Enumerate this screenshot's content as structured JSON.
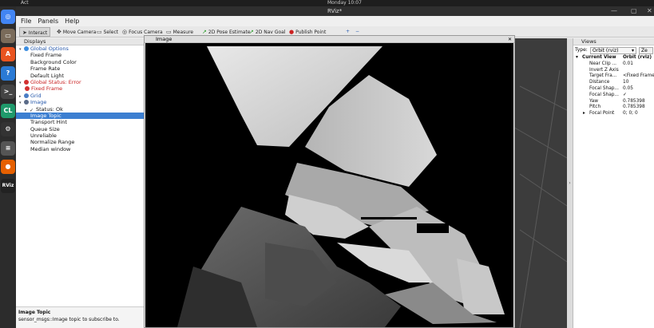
{
  "topbar": {
    "activities": "Act",
    "clock": "Monday 10:07"
  },
  "window": {
    "title": "RViz*"
  },
  "menu": [
    "File",
    "Panels",
    "Help"
  ],
  "toolbar": [
    {
      "label": "Interact",
      "icon": "cursor-icon",
      "active": true
    },
    {
      "label": "Move Camera",
      "icon": "move-camera-icon",
      "active": false
    },
    {
      "label": "Select",
      "icon": "select-icon",
      "active": false
    },
    {
      "label": "Focus Camera",
      "icon": "focus-camera-icon",
      "active": false
    },
    {
      "label": "Measure",
      "icon": "measure-icon",
      "active": false
    },
    {
      "label": "2D Pose Estimate",
      "icon": "pose-estimate-icon",
      "active": false
    },
    {
      "label": "2D Nav Goal",
      "icon": "nav-goal-icon",
      "active": false
    },
    {
      "label": "Publish Point",
      "icon": "publish-point-icon",
      "active": false
    }
  ],
  "displays": {
    "header": "Displays",
    "items": [
      {
        "text": "Global Options",
        "indent": 0,
        "twisty": "▾",
        "kind": "gear",
        "style": "blue"
      },
      {
        "text": "Fixed Frame",
        "indent": 2,
        "style": ""
      },
      {
        "text": "Background Color",
        "indent": 2,
        "style": ""
      },
      {
        "text": "Frame Rate",
        "indent": 2,
        "style": ""
      },
      {
        "text": "Default Light",
        "indent": 2,
        "style": ""
      },
      {
        "text": "Global Status: Error",
        "indent": 0,
        "twisty": "▾",
        "kind": "error",
        "style": "err"
      },
      {
        "text": "Fixed Frame",
        "indent": 1,
        "kind": "error",
        "style": "err"
      },
      {
        "text": "Grid",
        "indent": 0,
        "twisty": "▸",
        "kind": "grid",
        "style": "blue"
      },
      {
        "text": "Image",
        "indent": 0,
        "twisty": "▾",
        "kind": "image",
        "style": "blue"
      },
      {
        "text": "Status: Ok",
        "indent": 1,
        "twisty": "▸",
        "kind": "ok",
        "style": ""
      },
      {
        "text": "Image Topic",
        "indent": 2,
        "style": "",
        "selected": true
      },
      {
        "text": "Transport Hint",
        "indent": 2,
        "style": ""
      },
      {
        "text": "Queue Size",
        "indent": 2,
        "style": ""
      },
      {
        "text": "Unreliable",
        "indent": 2,
        "style": ""
      },
      {
        "text": "Normalize Range",
        "indent": 2,
        "style": ""
      },
      {
        "text": "Median window",
        "indent": 2,
        "style": ""
      }
    ],
    "description_title": "Image Topic",
    "description_text": "sensor_msgs::Image topic to subscribe to."
  },
  "image_panel": {
    "title": "Image"
  },
  "views": {
    "header": "Views",
    "type_label": "Type:",
    "type_value": "Orbit (rviz)",
    "zero_button": "Ze",
    "rows": [
      {
        "key": "Current View",
        "value": "Orbit (rviz)",
        "head": true
      },
      {
        "key": "Near Clip ...",
        "value": "0.01"
      },
      {
        "key": "Invert Z Axis",
        "value": ""
      },
      {
        "key": "Target Fra...",
        "value": "<Fixed Frame"
      },
      {
        "key": "Distance",
        "value": "10"
      },
      {
        "key": "Focal Shap...",
        "value": "0.05"
      },
      {
        "key": "Focal Shap...",
        "value": "✓"
      },
      {
        "key": "Yaw",
        "value": "0.785398"
      },
      {
        "key": "Pitch",
        "value": "0.785398"
      },
      {
        "key": "Focal Point",
        "value": "0; 0; 0"
      }
    ]
  },
  "dock": [
    {
      "name": "chrome-icon",
      "color": "#4285f4",
      "glyph": "◎"
    },
    {
      "name": "files-icon",
      "color": "#7a6b5a",
      "glyph": "▭"
    },
    {
      "name": "software-icon",
      "color": "#e95420",
      "glyph": "A"
    },
    {
      "name": "help-icon",
      "color": "#2a7ad5",
      "glyph": "?"
    },
    {
      "name": "terminal-icon",
      "color": "#444",
      "glyph": ">_"
    },
    {
      "name": "clion-icon",
      "color": "#1f9a6b",
      "glyph": "CL"
    },
    {
      "name": "tool-icon",
      "color": "#333",
      "glyph": "⚙"
    },
    {
      "name": "layers-icon",
      "color": "#555",
      "glyph": "≡"
    },
    {
      "name": "firefox-icon",
      "color": "#e66000",
      "glyph": "●"
    },
    {
      "name": "rviz-icon",
      "color": "#222",
      "glyph": "RViz"
    }
  ]
}
